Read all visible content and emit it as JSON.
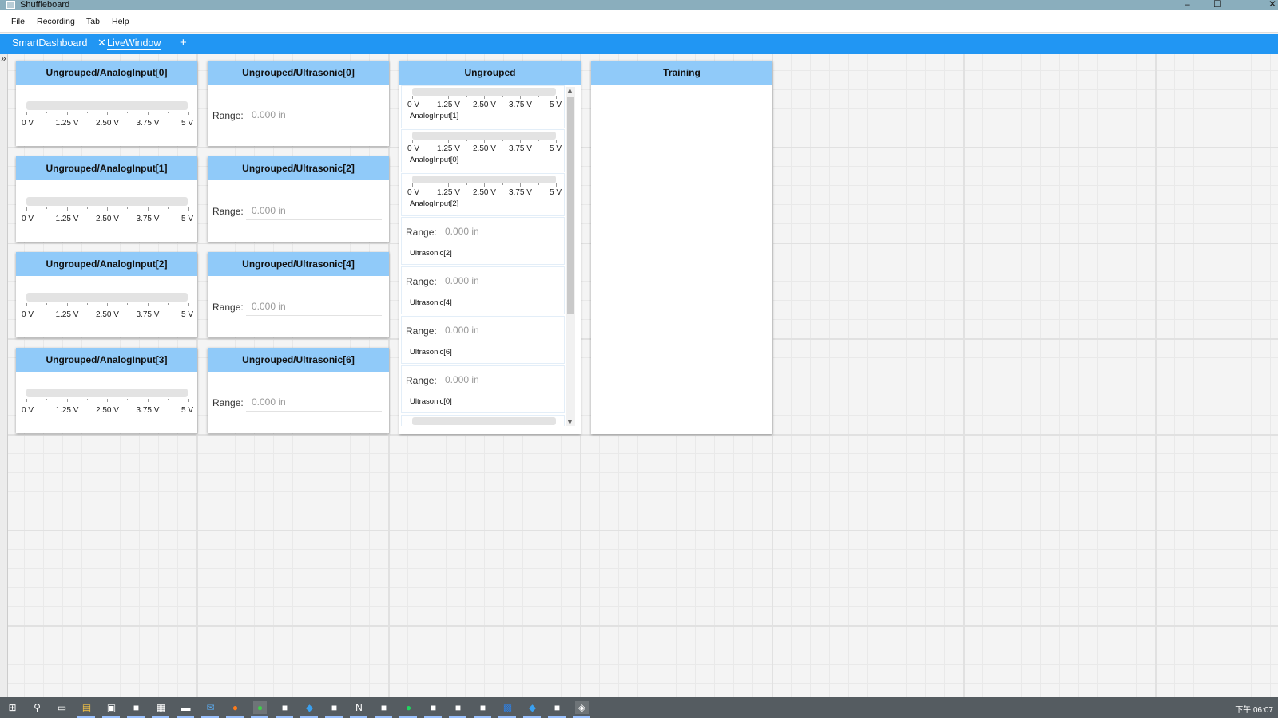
{
  "window": {
    "title": "Shuffleboard",
    "minimize": "–",
    "maximize": "☐",
    "close": "✕"
  },
  "menu": {
    "items": [
      "File",
      "Recording",
      "Tab",
      "Help"
    ]
  },
  "tabs": {
    "items": [
      "SmartDashboard",
      "LiveWindow"
    ],
    "active": "LiveWindow",
    "close_glyph": "✕",
    "add_glyph": "+"
  },
  "sidebar": {
    "expand_glyph": "»"
  },
  "scale_labels": [
    "0 V",
    "1.25 V",
    "2.50 V",
    "3.75 V",
    "5 V"
  ],
  "range": {
    "label": "Range:",
    "value": "0.000 in"
  },
  "analog_widgets": [
    {
      "title": "Ungrouped/AnalogInput[0]",
      "value": 0
    },
    {
      "title": "Ungrouped/AnalogInput[1]",
      "value": 0
    },
    {
      "title": "Ungrouped/AnalogInput[2]",
      "value": 0
    },
    {
      "title": "Ungrouped/AnalogInput[3]",
      "value": 0
    }
  ],
  "ultrasonic_widgets": [
    {
      "title": "Ungrouped/Ultrasonic[0]"
    },
    {
      "title": "Ungrouped/Ultrasonic[2]"
    },
    {
      "title": "Ungrouped/Ultrasonic[4]"
    },
    {
      "title": "Ungrouped/Ultrasonic[6]"
    }
  ],
  "ungrouped": {
    "title": "Ungrouped",
    "items": [
      {
        "kind": "analog",
        "name": "AnalogInput[1]"
      },
      {
        "kind": "analog",
        "name": "AnalogInput[0]"
      },
      {
        "kind": "analog",
        "name": "AnalogInput[2]"
      },
      {
        "kind": "range",
        "name": "Ultrasonic[2]"
      },
      {
        "kind": "range",
        "name": "Ultrasonic[4]"
      },
      {
        "kind": "range",
        "name": "Ultrasonic[6]"
      },
      {
        "kind": "range",
        "name": "Ultrasonic[0]"
      }
    ],
    "scroll_up": "▲",
    "scroll_down": "▼"
  },
  "training": {
    "title": "Training"
  },
  "taskbar": {
    "icons": [
      "windows-start-icon",
      "search-icon",
      "task-view-icon",
      "file-explorer-icon",
      "store-icon",
      "app-icon",
      "calculator-icon",
      "terminal-icon",
      "mail-icon",
      "firefox-icon",
      "line-icon",
      "app-icon",
      "vscode-icon",
      "app-icon",
      "notion-icon",
      "app-icon",
      "spotify-icon",
      "app-icon",
      "app-icon",
      "app-icon",
      "outlook-icon",
      "vscode-icon",
      "app-icon",
      "shuffleboard-icon"
    ],
    "clock": "下午 06:07"
  },
  "colors": {
    "titlebar": "#8aaebd",
    "tabbar": "#2196f3",
    "widget_header": "#90caf9",
    "taskbar": "#555c61"
  }
}
